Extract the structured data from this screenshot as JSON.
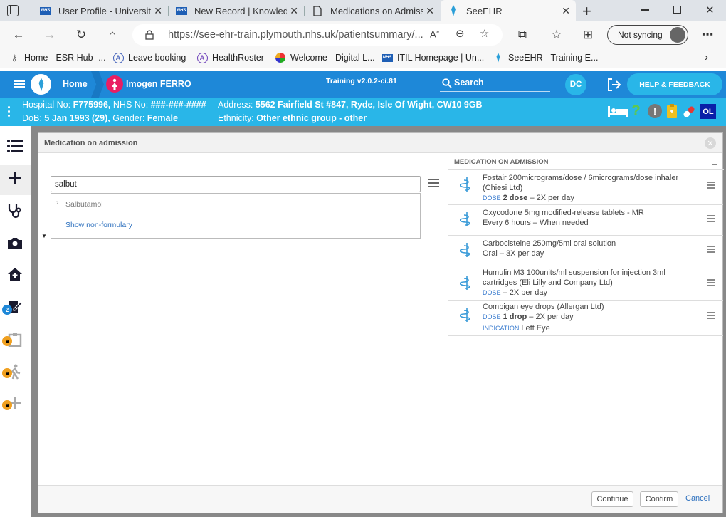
{
  "browser": {
    "tabs": [
      {
        "title": "User Profile - University",
        "icon": "nhs-icon"
      },
      {
        "title": "New Record | Knowledg",
        "icon": "nhs-icon"
      },
      {
        "title": "Medications on Admiss",
        "icon": "page-icon"
      },
      {
        "title": "SeeEHR",
        "icon": "seeehr-icon",
        "active": true
      }
    ],
    "url": "https://see-ehr-train.plymouth.nhs.uk/patientsummary/...",
    "sync_label": "Not syncing",
    "bookmarks": [
      {
        "label": "Home - ESR Hub -...",
        "icon": "key-icon"
      },
      {
        "label": "Leave booking",
        "icon": "a-logo-icon"
      },
      {
        "label": "HealthRoster",
        "icon": "a-purple-icon"
      },
      {
        "label": "Welcome - Digital L...",
        "icon": "globe-icon"
      },
      {
        "label": "ITIL Homepage | Un...",
        "icon": "nhs-icon"
      },
      {
        "label": "SeeEHR - Training E...",
        "icon": "seeehr-icon"
      }
    ]
  },
  "app": {
    "home_label": "Home",
    "patient_name": "Imogen FERRO",
    "version": "Training v2.0.2-ci.81",
    "search_label": "Search",
    "user_initials": "DC",
    "help_label": "HELP & FEEDBACK",
    "ol_badge": "OL"
  },
  "patient": {
    "hospital_label": "Hospital No:",
    "hospital_no": "F775996,",
    "nhs_label": "NHS No:",
    "nhs_no": "###-###-####",
    "address_label": "Address:",
    "address": "5562 Fairfield St #847, Ryde, Isle Of Wight, CW10 9GB",
    "dob_label": "DoB:",
    "dob": "5 Jan 1993 (29),",
    "gender_label": "Gender:",
    "gender": "Female",
    "ethnicity_label": "Ethnicity:",
    "ethnicity": "Other ethnic group - other"
  },
  "sidebar": {
    "badge_count": "2",
    "colors": {
      "lock_badge": "#f0a020",
      "count_badge": "#1e88d8"
    }
  },
  "modal": {
    "title": "Medication on admission",
    "search_value": "salbut",
    "dropdown": {
      "result": "Salbutamol",
      "non_formulary_link": "Show non-formulary"
    },
    "right_header": "MEDICATION ON ADMISSION",
    "medications": [
      {
        "name": "Fostair 200micrograms/dose / 6micrograms/dose inhaler (Chiesi Ltd)",
        "dose_label": "DOSE",
        "dose_value": "2 dose",
        "detail": "– 2X per day"
      },
      {
        "name": "Oxycodone 5mg modified-release tablets - MR",
        "detail": "Every 6 hours – When needed"
      },
      {
        "name": "Carbocisteine 250mg/5ml oral solution",
        "detail": "Oral – 3X per day"
      },
      {
        "name": "Humulin M3 100units/ml suspension for injection 3ml cartridges (Eli Lilly and Company Ltd)",
        "dose_label": "DOSE",
        "detail": "– 2X per day"
      },
      {
        "name": "Combigan eye drops (Allergan Ltd)",
        "dose_label": "DOSE",
        "dose_value": "1 drop",
        "detail": "– 2X per day",
        "indication_label": "INDICATION",
        "indication_value": "Left Eye"
      }
    ],
    "buttons": {
      "continue": "Continue",
      "confirm": "Confirm",
      "cancel": "Cancel"
    }
  }
}
